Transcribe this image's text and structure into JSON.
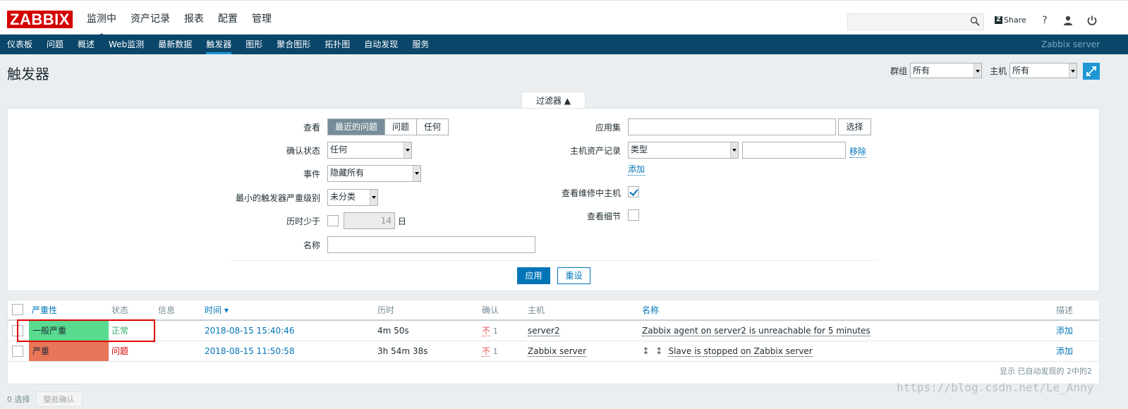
{
  "header": {
    "logo": "ZABBIX",
    "nav": [
      "监测中",
      "资产记录",
      "报表",
      "配置",
      "管理"
    ],
    "share_label": "Share",
    "help_icon": "?",
    "icons": [
      "search-icon",
      "help-icon",
      "user-icon",
      "power-icon"
    ]
  },
  "subnav": {
    "items": [
      "仪表板",
      "问题",
      "概述",
      "Web监测",
      "最新数据",
      "触发器",
      "图形",
      "聚合图形",
      "拓扑图",
      "自动发现",
      "服务"
    ],
    "server": "Zabbix server"
  },
  "page": {
    "title": "触发器",
    "group_label": "群组",
    "group_value": "所有",
    "host_label": "主机",
    "host_value": "所有"
  },
  "filter": {
    "tab_label": "过滤器 ▲",
    "view_label": "查看",
    "view_options": [
      "最近的问题",
      "问题",
      "任何"
    ],
    "ack_label": "确认状态",
    "ack_value": "任何",
    "event_label": "事件",
    "event_value": "隐藏所有",
    "severity_label": "最小的触发器严重级别",
    "severity_value": "未分类",
    "age_label": "历时少于",
    "age_value": "14",
    "age_unit": "日",
    "name_label": "名称",
    "appset_label": "应用集",
    "select_button": "选择",
    "inventory_label": "主机资产记录",
    "inventory_type": "类型",
    "remove_link": "移除",
    "add_link": "添加",
    "maintenance_label": "查看维修中主机",
    "details_label": "查看细节",
    "apply_button": "应用",
    "reset_button": "重设"
  },
  "table": {
    "columns": [
      "严重性",
      "状态",
      "信息",
      "时间 ▾",
      "历时",
      "确认",
      "主机",
      "名称",
      "描述"
    ],
    "rows": [
      {
        "severity": "一般严重",
        "severity_color": "#59db8f",
        "status": "正常",
        "status_color": "#34af67",
        "time": "2018-08-15 15:40:46",
        "duration": "4m 50s",
        "ack": "不",
        "ack_count": "1",
        "host": "server2",
        "name": "Zabbix agent on server2 is unreachable for 5 minutes",
        "desc": "添加"
      },
      {
        "severity": "严重",
        "severity_color": "#e97659",
        "status": "问题",
        "status_color": "#dc0000",
        "time": "2018-08-15 11:50:58",
        "duration": "3h 54m 38s",
        "ack": "不",
        "ack_count": "1",
        "host": "Zabbix server",
        "name": "Slave is stopped on Zabbix server",
        "desc": "添加"
      }
    ],
    "summary": "显示 已自动发现的 2中的2"
  },
  "bottom": {
    "selected": "0 选择",
    "mass_ack": "整批确认"
  },
  "watermark": "https://blog.csdn.net/Le_Anny"
}
